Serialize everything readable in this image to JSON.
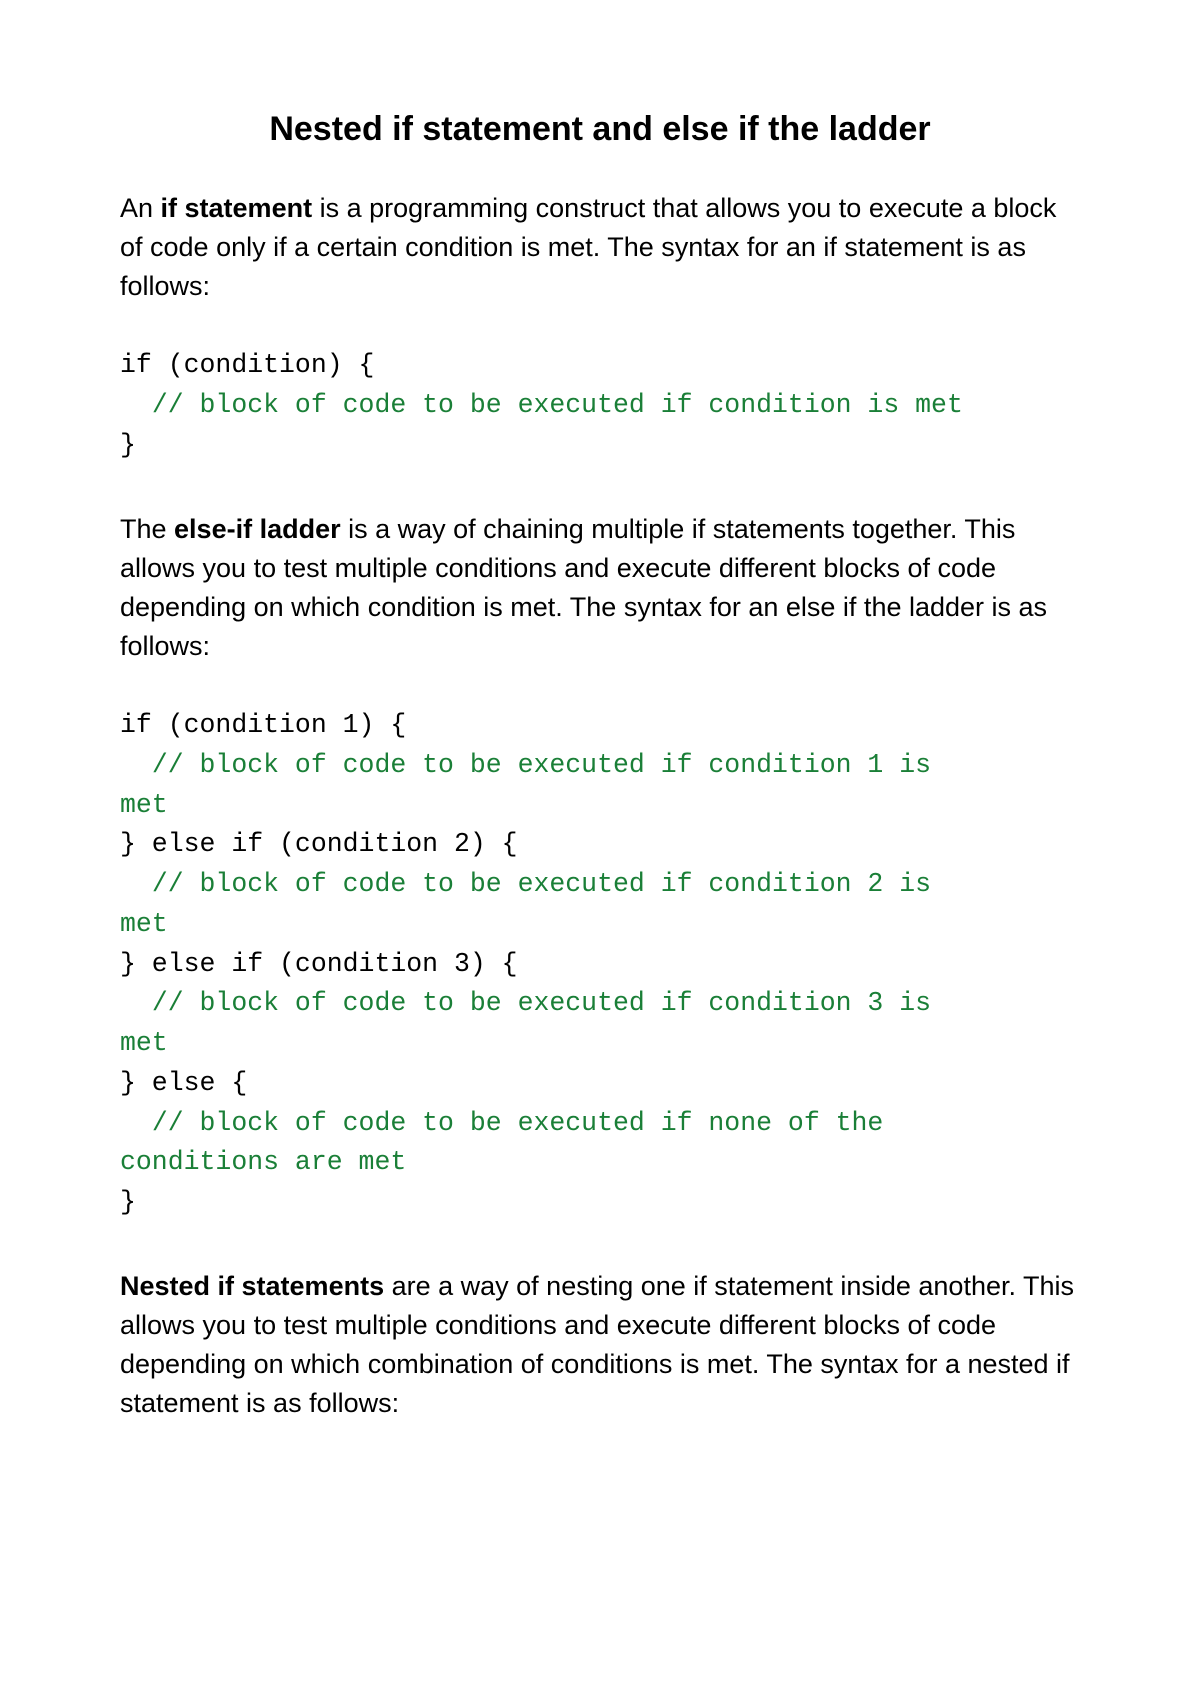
{
  "title": "Nested if statement and else if the ladder",
  "para1": {
    "pre": "An ",
    "bold": "if statement",
    "post": " is a programming construct that allows you to execute a block of code only if a certain condition is met. The syntax for an if statement is as follows:"
  },
  "code1": {
    "l1": "if (condition) {",
    "l2": "  // block of code to be executed if condition is met",
    "l3": "}"
  },
  "para2": {
    "pre": "The ",
    "bold": "else-if ladder",
    "post": " is a way of chaining multiple if statements together. This allows you to test multiple conditions and execute different blocks of code depending on which condition is met. The syntax for an else if the ladder is as follows:"
  },
  "code2": {
    "l1": "if (condition 1) {",
    "l2a": "  // block of code to be executed if condition 1 is",
    "l2b": "met",
    "l3": "} else if (condition 2) {",
    "l4a": "  // block of code to be executed if condition 2 is",
    "l4b": "met",
    "l5": "} else if (condition 3) {",
    "l6a": "  // block of code to be executed if condition 3 is",
    "l6b": "met",
    "l7": "} else {",
    "l8a": "  // block of code to be executed if none of the",
    "l8b": "conditions are met",
    "l9": "}"
  },
  "para3": {
    "bold": "Nested if statements",
    "post": " are a way of nesting one if statement inside another. This allows you to test multiple conditions and execute different blocks of code depending on which combination of conditions is met. The syntax for a nested if statement is as follows:"
  }
}
